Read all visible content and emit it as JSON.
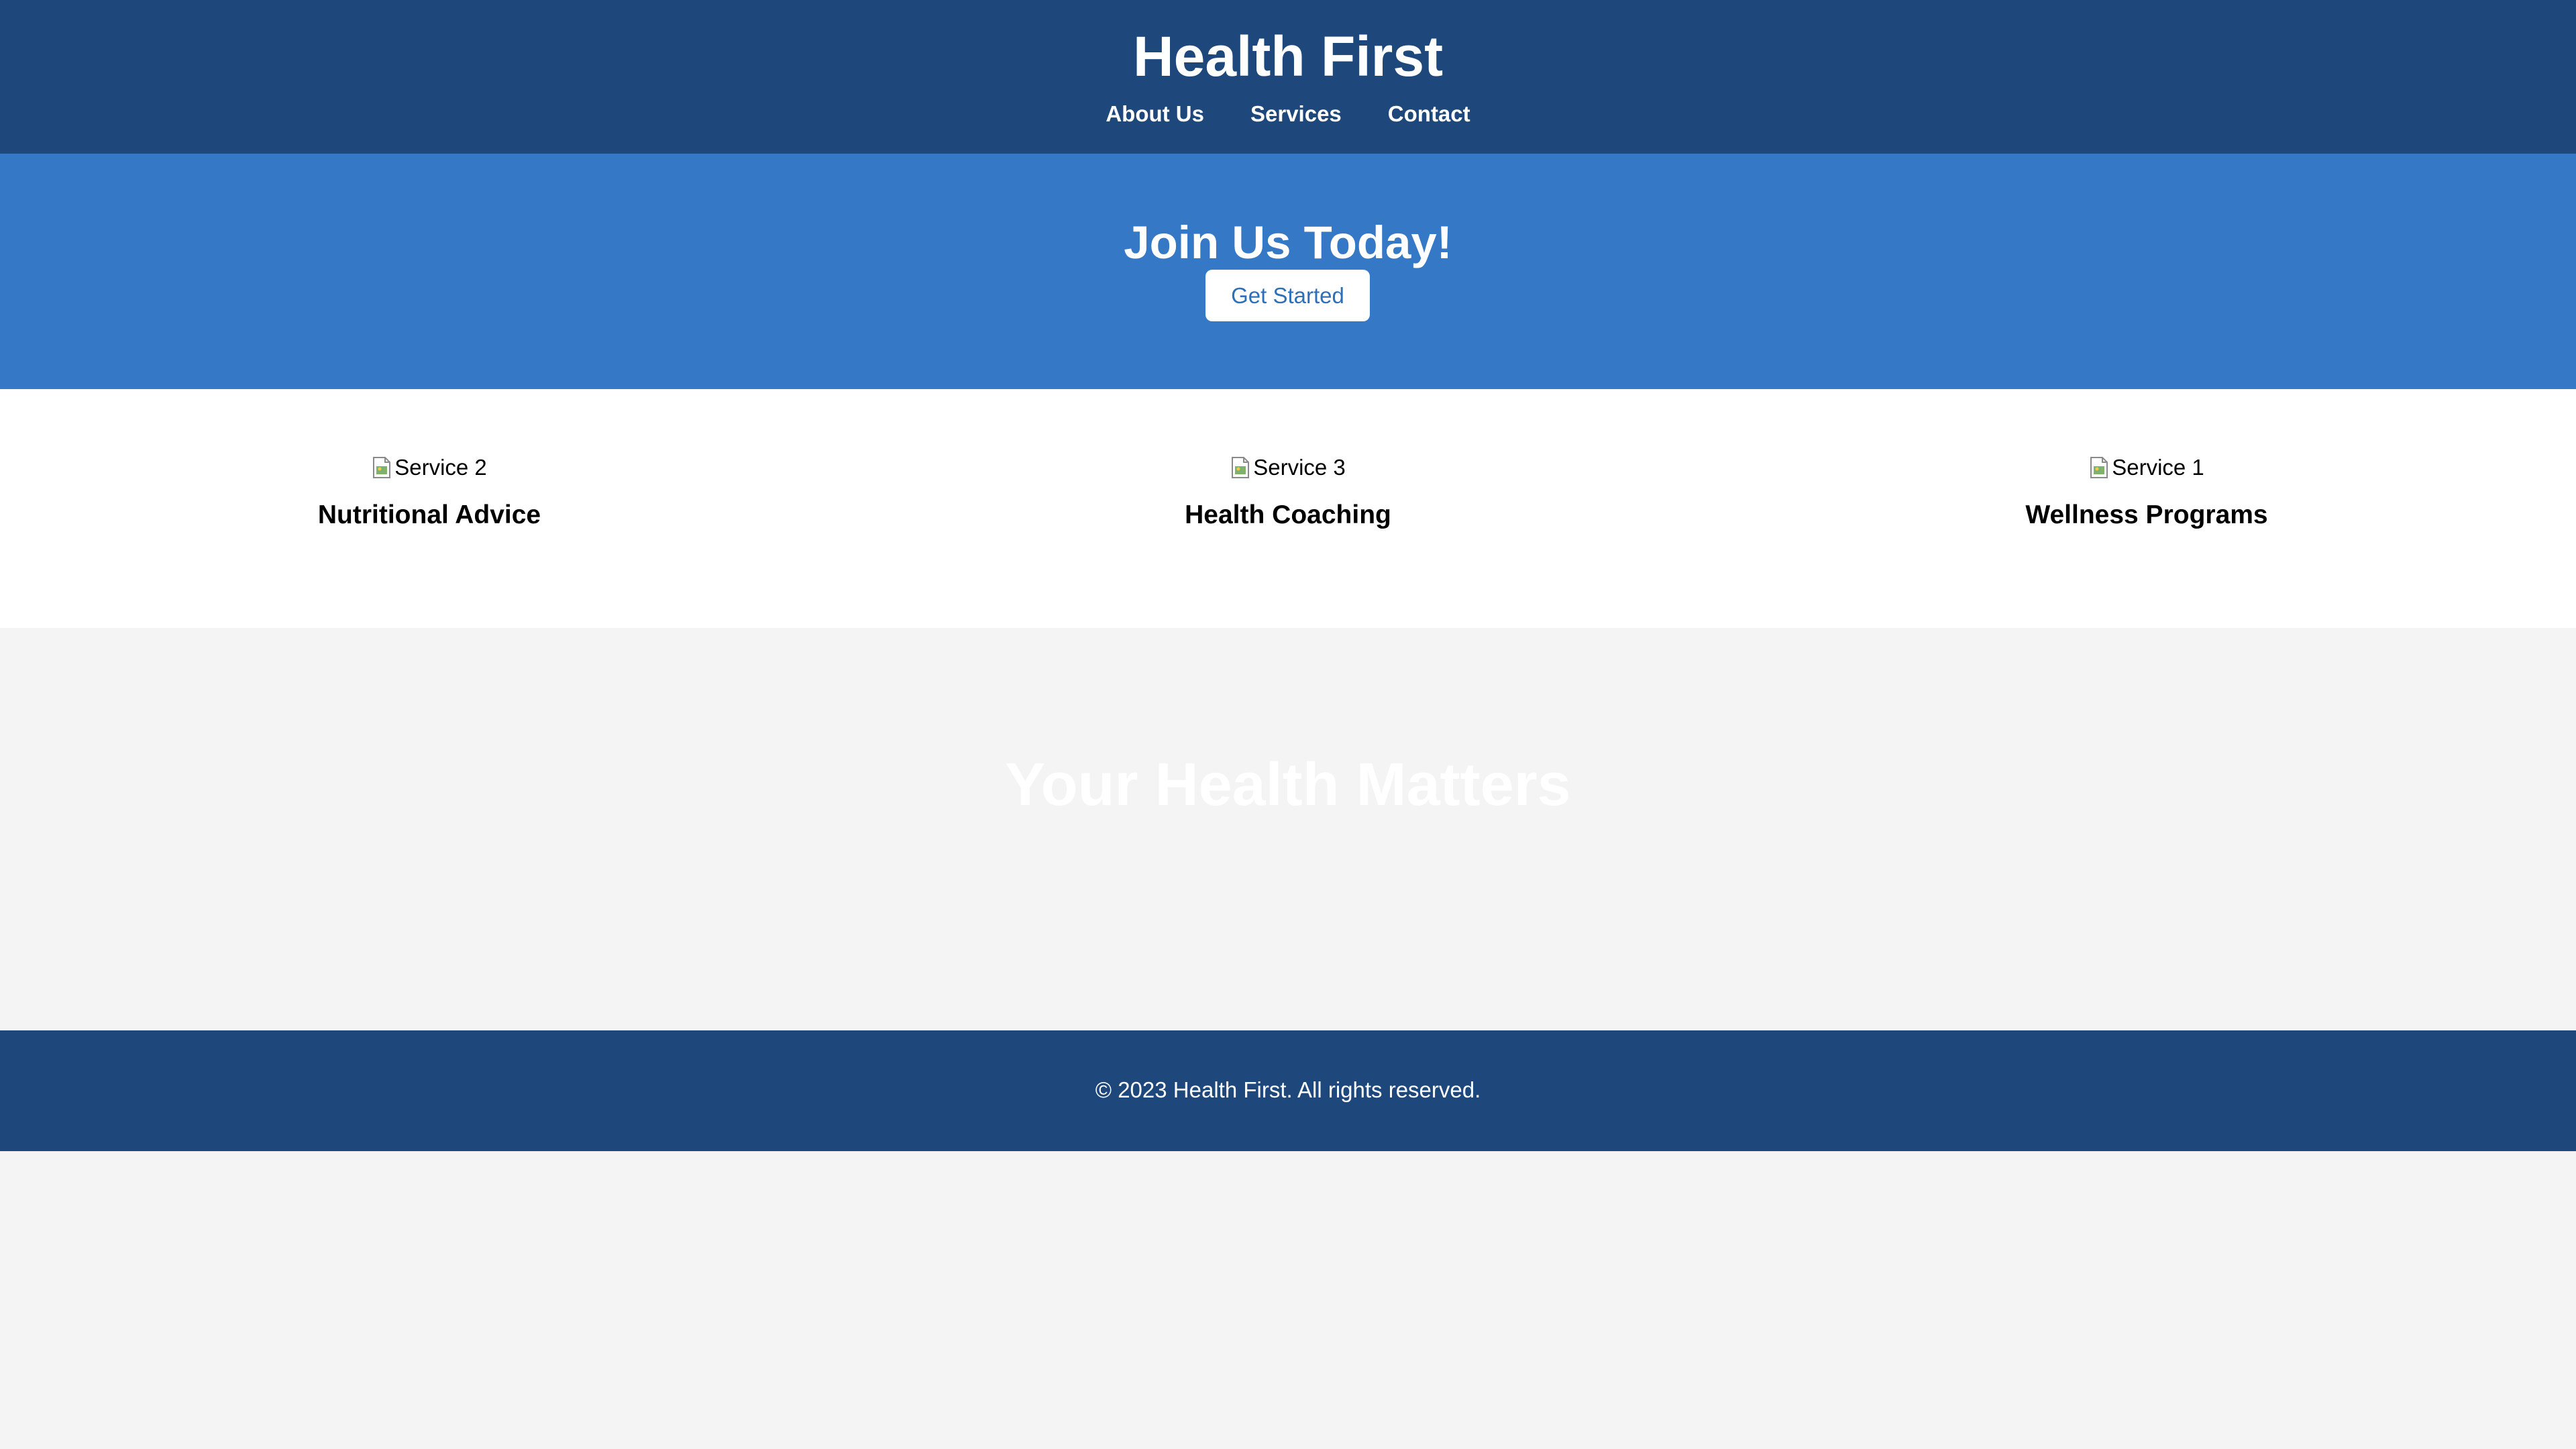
{
  "header": {
    "title": "Health First",
    "nav": [
      {
        "label": "About Us"
      },
      {
        "label": "Services"
      },
      {
        "label": "Contact"
      }
    ]
  },
  "hero": {
    "title": "Join Us Today!",
    "button_label": "Get Started"
  },
  "services": [
    {
      "image_alt": "Service 2",
      "title": "Nutritional Advice"
    },
    {
      "image_alt": "Service 3",
      "title": "Health Coaching"
    },
    {
      "image_alt": "Service 1",
      "title": "Wellness Programs"
    }
  ],
  "banner": {
    "title": "Your Health Matters"
  },
  "footer": {
    "text": "© 2023 Health First. All rights reserved."
  },
  "colors": {
    "header_bg": "#1e487c",
    "hero_bg": "#3578c6",
    "page_bg": "#f4f4f4",
    "button_text": "#2d6fb9"
  },
  "icons": {
    "service_image": "broken-image-icon"
  }
}
